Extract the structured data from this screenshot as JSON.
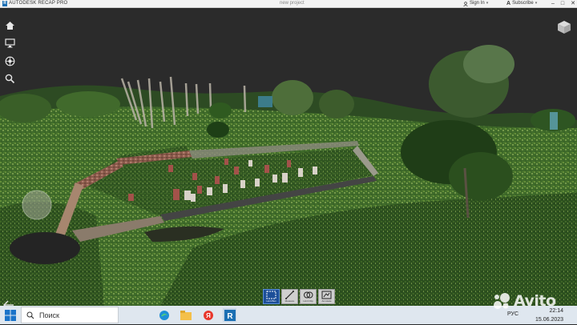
{
  "titlebar": {
    "app_title": "AUTODESK RECAP PRO",
    "document_title": "new project",
    "sign_in": "Sign In",
    "subscribe": "Subscribe"
  },
  "left_nav": {
    "icons": [
      "home-icon",
      "display-icon",
      "settings-wheel-icon",
      "search-icon"
    ]
  },
  "toolbar": {
    "tools": [
      {
        "name": "limit-box-tool",
        "label": "Limit Box",
        "active": true
      },
      {
        "name": "measure-tool",
        "label": "Measure",
        "active": false
      },
      {
        "name": "limit-clip-tool",
        "label": "Limit Clip",
        "active": false
      },
      {
        "name": "annotate-tool",
        "label": "Annotate",
        "active": false
      }
    ]
  },
  "taskbar": {
    "search_placeholder": "Поиск",
    "apps": [
      "edge-icon",
      "file-explorer-icon",
      "yandex-browser-icon",
      "recap-app-icon"
    ],
    "language": "РУС",
    "time": "22:14",
    "date": "15.06.2023"
  },
  "watermark": {
    "text": "Avito"
  },
  "colors": {
    "sky": "#2b2b2b",
    "accent": "#1d4f99",
    "recap_blue": "#1b6fb3"
  }
}
